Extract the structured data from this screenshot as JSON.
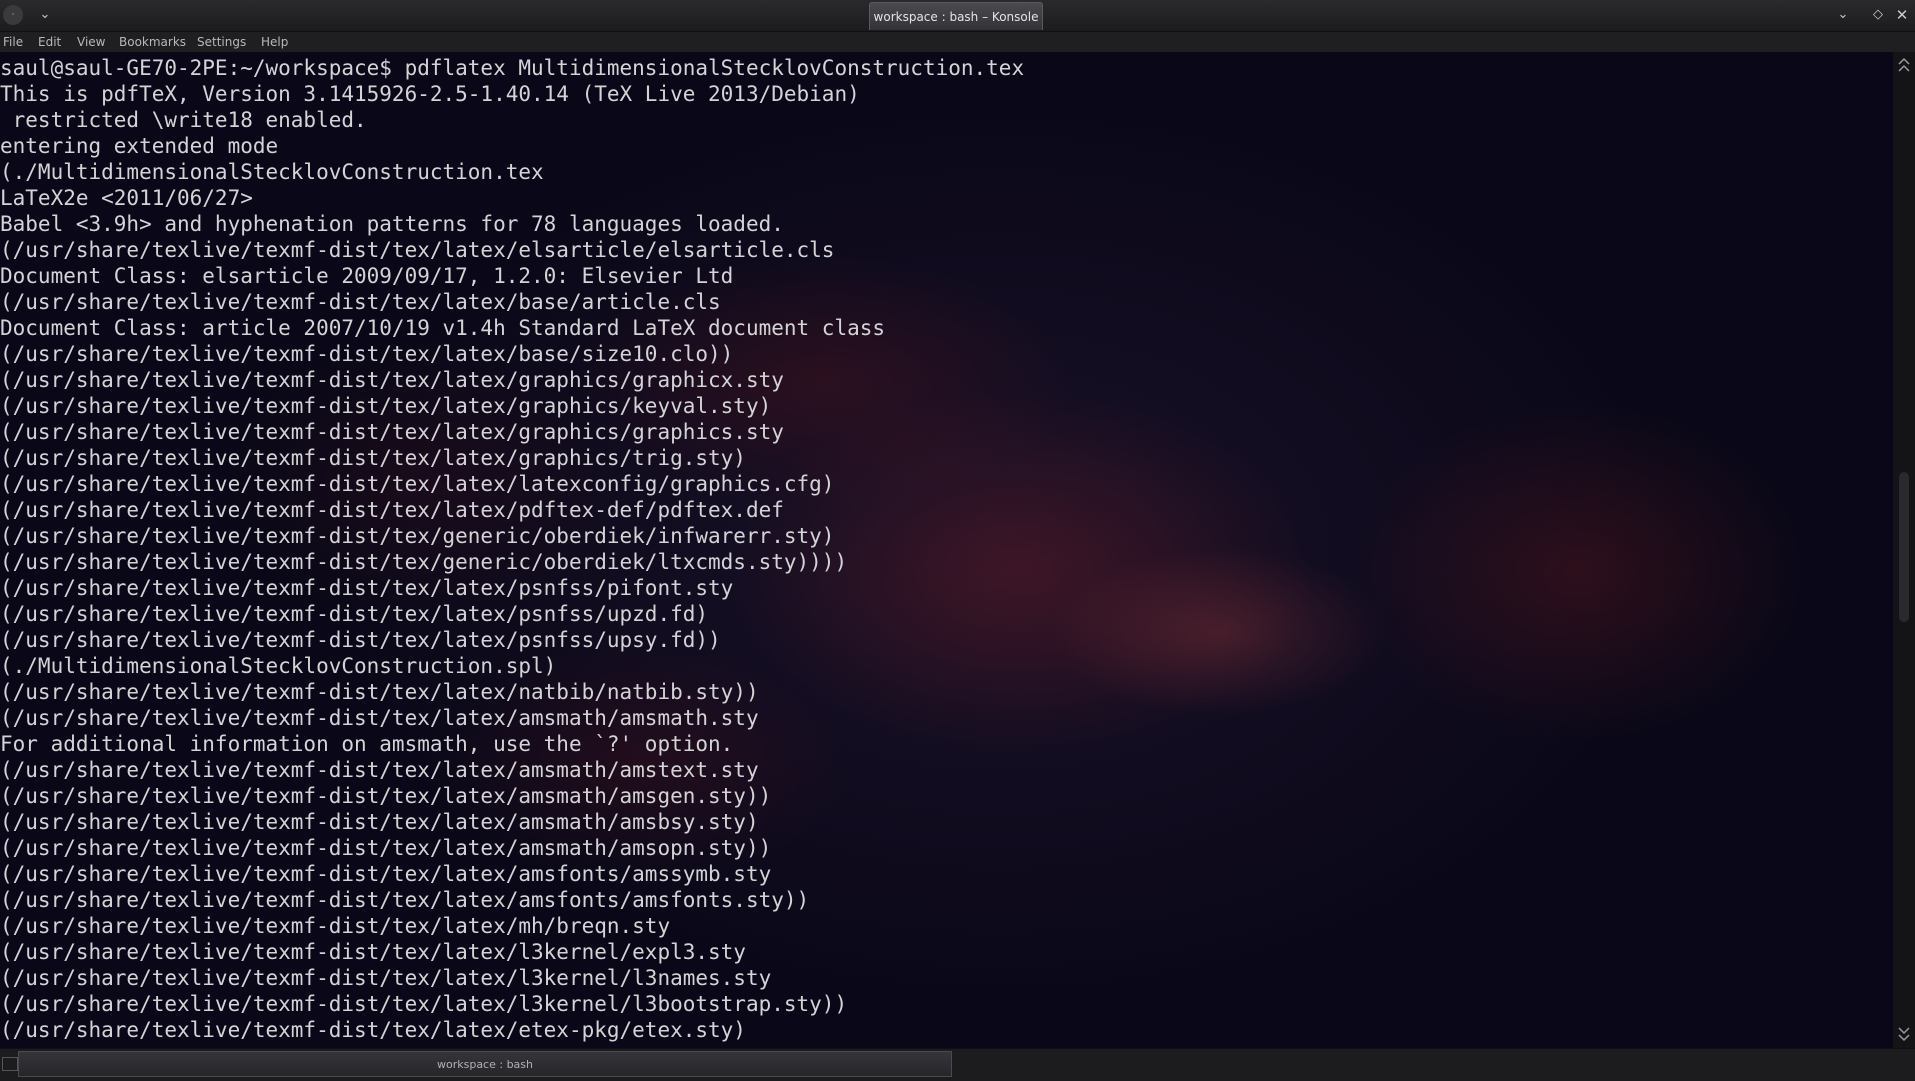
{
  "window": {
    "title": "workspace : bash – Konsole"
  },
  "titlebar": {
    "icons": [
      "window-menu-icon",
      "keep-above-icon",
      "minimize-icon",
      "maximize-icon",
      "close-icon"
    ],
    "menu_glyph": "·",
    "keep_glyph": "⌄",
    "minimize_glyph": "⌄",
    "maximize_glyph": "◇",
    "close_glyph": "✕"
  },
  "menubar": {
    "items": [
      "File",
      "Edit",
      "View",
      "Bookmarks",
      "Settings",
      "Help"
    ]
  },
  "terminal": {
    "lines": [
      "saul@saul-GE70-2PE:~/workspace$ pdflatex MultidimensionalStecklovConstruction.tex",
      "This is pdfTeX, Version 3.1415926-2.5-1.40.14 (TeX Live 2013/Debian)",
      " restricted \\write18 enabled.",
      "entering extended mode",
      "(./MultidimensionalStecklovConstruction.tex",
      "LaTeX2e <2011/06/27>",
      "Babel <3.9h> and hyphenation patterns for 78 languages loaded.",
      "(/usr/share/texlive/texmf-dist/tex/latex/elsarticle/elsarticle.cls",
      "Document Class: elsarticle 2009/09/17, 1.2.0: Elsevier Ltd",
      "(/usr/share/texlive/texmf-dist/tex/latex/base/article.cls",
      "Document Class: article 2007/10/19 v1.4h Standard LaTeX document class",
      "(/usr/share/texlive/texmf-dist/tex/latex/base/size10.clo))",
      "(/usr/share/texlive/texmf-dist/tex/latex/graphics/graphicx.sty",
      "(/usr/share/texlive/texmf-dist/tex/latex/graphics/keyval.sty)",
      "(/usr/share/texlive/texmf-dist/tex/latex/graphics/graphics.sty",
      "(/usr/share/texlive/texmf-dist/tex/latex/graphics/trig.sty)",
      "(/usr/share/texlive/texmf-dist/tex/latex/latexconfig/graphics.cfg)",
      "(/usr/share/texlive/texmf-dist/tex/latex/pdftex-def/pdftex.def",
      "(/usr/share/texlive/texmf-dist/tex/generic/oberdiek/infwarerr.sty)",
      "(/usr/share/texlive/texmf-dist/tex/generic/oberdiek/ltxcmds.sty))))",
      "(/usr/share/texlive/texmf-dist/tex/latex/psnfss/pifont.sty",
      "(/usr/share/texlive/texmf-dist/tex/latex/psnfss/upzd.fd)",
      "(/usr/share/texlive/texmf-dist/tex/latex/psnfss/upsy.fd))",
      "(./MultidimensionalStecklovConstruction.spl)",
      "(/usr/share/texlive/texmf-dist/tex/latex/natbib/natbib.sty))",
      "(/usr/share/texlive/texmf-dist/tex/latex/amsmath/amsmath.sty",
      "For additional information on amsmath, use the `?' option.",
      "(/usr/share/texlive/texmf-dist/tex/latex/amsmath/amstext.sty",
      "(/usr/share/texlive/texmf-dist/tex/latex/amsmath/amsgen.sty))",
      "(/usr/share/texlive/texmf-dist/tex/latex/amsmath/amsbsy.sty)",
      "(/usr/share/texlive/texmf-dist/tex/latex/amsmath/amsopn.sty))",
      "(/usr/share/texlive/texmf-dist/tex/latex/amsfonts/amssymb.sty",
      "(/usr/share/texlive/texmf-dist/tex/latex/amsfonts/amsfonts.sty))",
      "(/usr/share/texlive/texmf-dist/tex/latex/mh/breqn.sty",
      "(/usr/share/texlive/texmf-dist/tex/latex/l3kernel/expl3.sty",
      "(/usr/share/texlive/texmf-dist/tex/latex/l3kernel/l3names.sty",
      "(/usr/share/texlive/texmf-dist/tex/latex/l3kernel/l3bootstrap.sty))",
      "(/usr/share/texlive/texmf-dist/tex/latex/etex-pkg/etex.sty)"
    ]
  },
  "scrollbar": {
    "up_glyph": "︿\n︿",
    "down_glyph": "﹀\n﹀"
  },
  "tabbar": {
    "new_tab_glyph": "▭",
    "session_tab_label": "workspace : bash"
  },
  "colors": {
    "terminal_text": "#d4d4d6",
    "terminal_background": "#0b0a1c",
    "chrome": "#1f1f22"
  }
}
